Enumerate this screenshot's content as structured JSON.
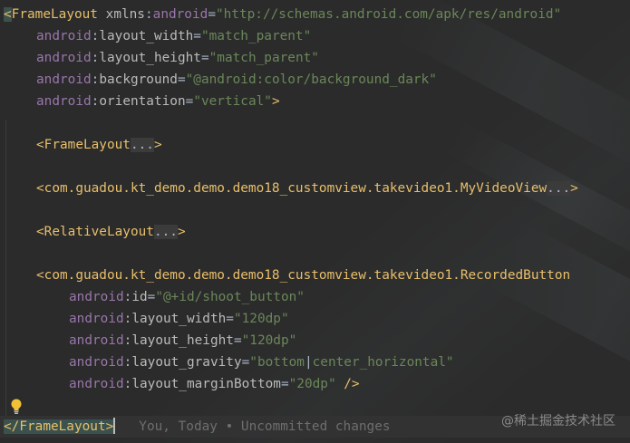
{
  "editor": {
    "lines": [
      {
        "open": "<",
        "tag": "FrameLayout",
        "rest_ns": "android",
        "rest_attr": "xmlns:",
        "value": "\"http://schemas.android.com/apk/res/android\""
      },
      {
        "ns": "android",
        "attr": "layout_width",
        "value": "\"match_parent\""
      },
      {
        "ns": "android",
        "attr": "layout_height",
        "value": "\"match_parent\""
      },
      {
        "ns": "android",
        "attr": "background",
        "value": "\"@android:color/background_dark\""
      },
      {
        "ns": "android",
        "attr": "orientation",
        "value": "\"vertical\"",
        "close": ">"
      },
      {
        "tag": "<FrameLayout",
        "fold": "...",
        "close": ">"
      },
      {
        "tag": "<com.guadou.kt_demo.demo.demo18_customview.takevideo1.MyVideoView",
        "fold": "...",
        "close": ">"
      },
      {
        "tag": "<RelativeLayout",
        "fold": "...",
        "close": ">"
      },
      {
        "tag": "<com.guadou.kt_demo.demo.demo18_customview.takevideo1.RecordedButton"
      },
      {
        "ns": "android",
        "attr": "id",
        "value": "\"@+id/shoot_button\""
      },
      {
        "ns": "android",
        "attr": "layout_width",
        "value": "\"120dp\""
      },
      {
        "ns": "android",
        "attr": "layout_height",
        "value": "\"120dp\""
      },
      {
        "ns": "android",
        "attr": "layout_gravity",
        "value_a": "\"bottom",
        "value_b": "center_horizontal\""
      },
      {
        "ns": "android",
        "attr": "layout_marginBottom",
        "value": "\"20dp\"",
        "close": " />"
      },
      {
        "tag": "</FrameLayout>",
        "annotation": "You, Today • Uncommitted changes"
      }
    ],
    "sep": ":",
    "eq": "=",
    "pipe": "|",
    "watermark": "@稀土掘金技术社区"
  },
  "colors": {
    "background": "#2b2b2b",
    "tag": "#e8bf6a",
    "namespace": "#9876aa",
    "attribute": "#bababa",
    "string": "#6a8759"
  },
  "icons": {
    "intention": "lightbulb-icon"
  }
}
